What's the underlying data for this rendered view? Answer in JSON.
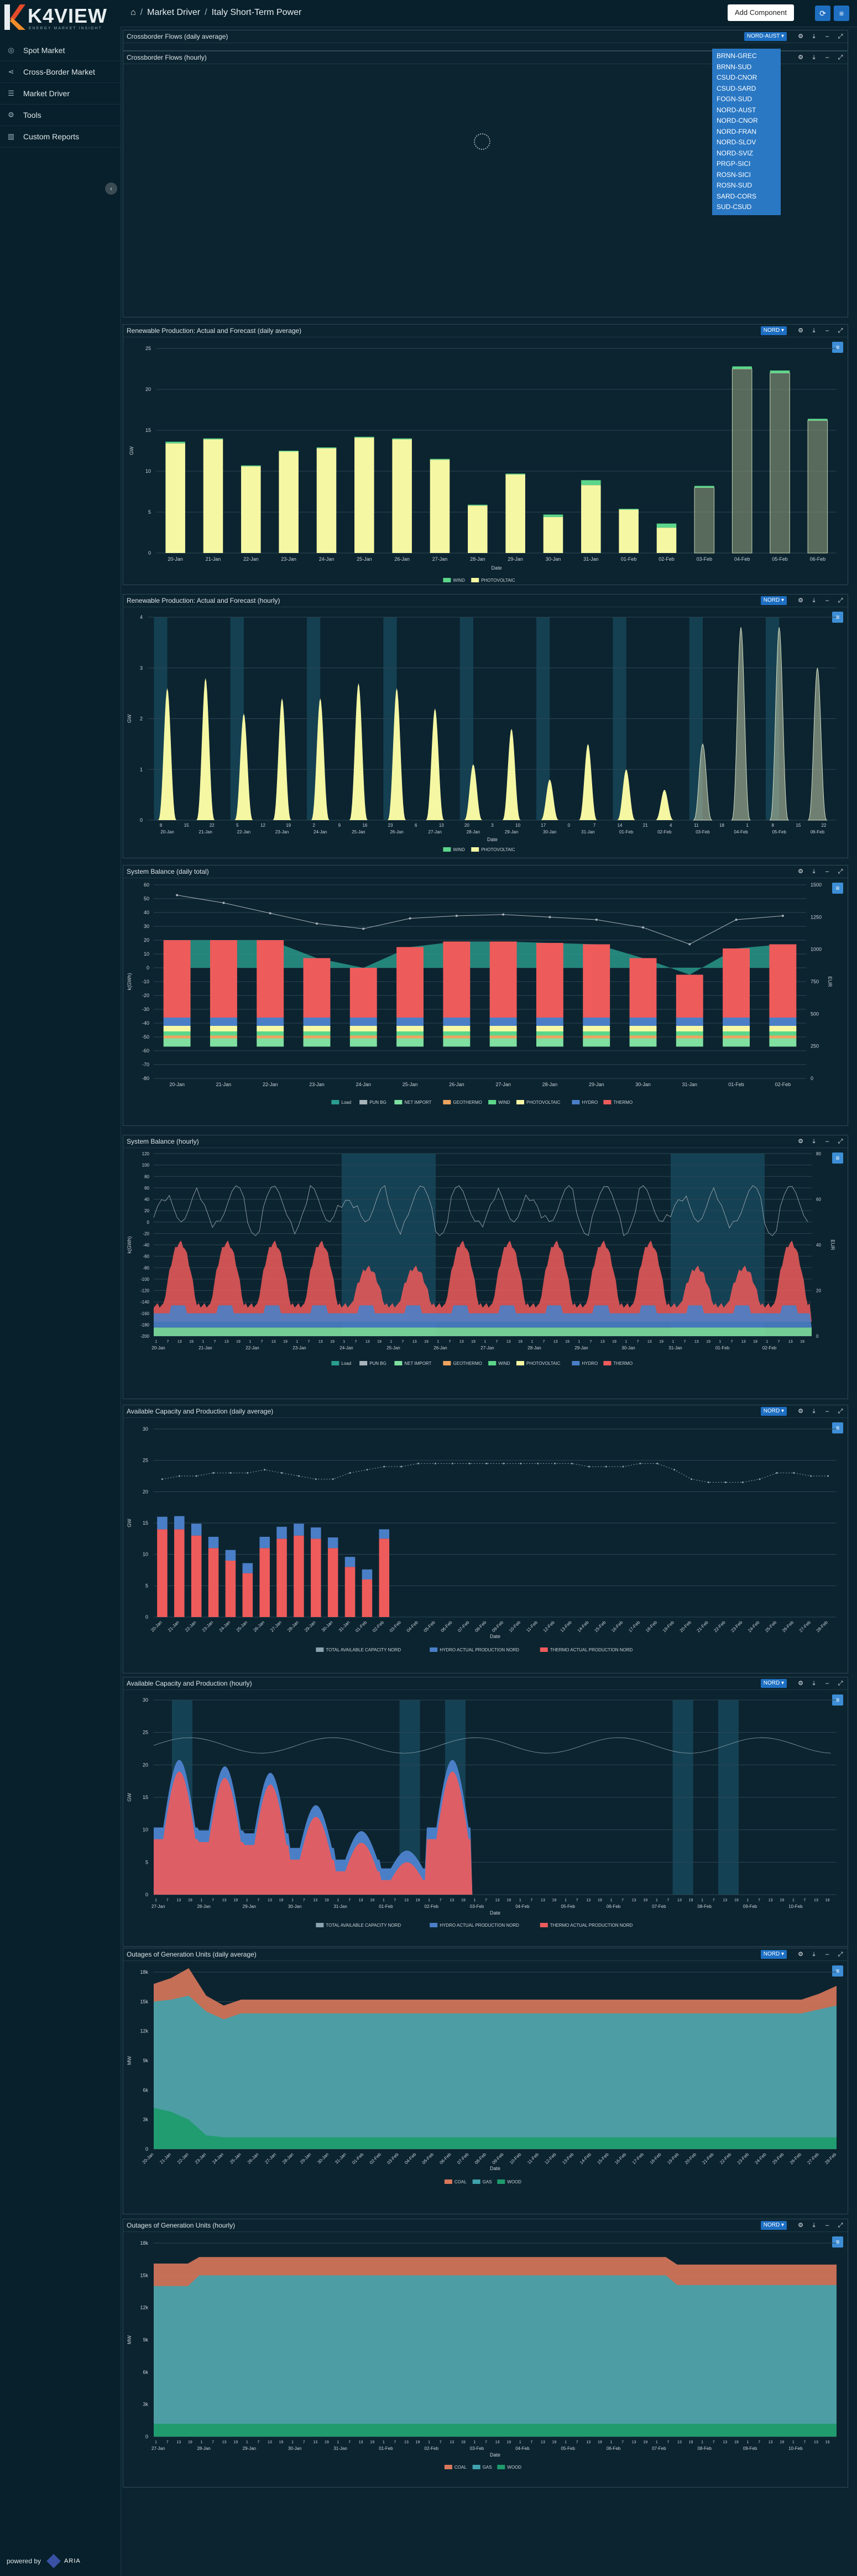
{
  "app": {
    "logo_text": "K4VIEW",
    "logo_sub": "ENERGY MARKET INSIGHT",
    "powered_by": "powered by",
    "powered_name": "ARIA"
  },
  "sidebar": {
    "items": [
      {
        "label": "Spot Market",
        "icon": "globe-icon"
      },
      {
        "label": "Cross-Border Market",
        "icon": "share-icon"
      },
      {
        "label": "Market Driver",
        "icon": "sliders-icon"
      },
      {
        "label": "Tools",
        "icon": "gear-icon"
      },
      {
        "label": "Custom Reports",
        "icon": "bar-chart-icon"
      }
    ]
  },
  "breadcrumb": {
    "parent": "Market Driver",
    "current": "Italy Short-Term Power"
  },
  "topbar": {
    "add_component": "Add Component"
  },
  "dropdown": {
    "selected": "NORD-AUST",
    "options": [
      "BRNN-GREC",
      "BRNN-SUD",
      "CSUD-CNOR",
      "CSUD-SARD",
      "FOGN-SUD",
      "NORD-AUST",
      "NORD-CNOR",
      "NORD-FRAN",
      "NORD-SLOV",
      "NORD-SVIZ",
      "PRGP-SICI",
      "ROSN-SICI",
      "ROSN-SUD",
      "SARD-CORS",
      "SUD-CSUD"
    ]
  },
  "panels": {
    "cbf_daily": {
      "title": "Crossborder Flows (daily average)"
    },
    "cbf_hourly": {
      "title": "Crossborder Flows (hourly)"
    },
    "ren_daily": {
      "title": "Renewable Production: Actual and Forecast (daily average)",
      "select": "NORD"
    },
    "ren_hourly": {
      "title": "Renewable Production: Actual and Forecast (hourly)",
      "select": "NORD"
    },
    "bal_daily": {
      "title": "System Balance (daily total)"
    },
    "bal_hourly": {
      "title": "System Balance (hourly)"
    },
    "cap_daily": {
      "title": "Available Capacity and Production (daily average)",
      "select": "NORD"
    },
    "cap_hourly": {
      "title": "Available Capacity and Production (hourly)",
      "select": "NORD"
    },
    "out_daily": {
      "title": "Outages of Generation Units (daily average)",
      "select": "NORD"
    },
    "out_hourly": {
      "title": "Outages of Generation Units (hourly)",
      "select": "NORD"
    }
  },
  "colors": {
    "wind": "#5cd68a",
    "photovoltaic": "#f5f7a3",
    "load": "#2a9d8f",
    "pun": "#a9b4ba",
    "net_import": "#7fe0a0",
    "geothermo": "#f0a35e",
    "hydro": "#4a7fc7",
    "thermo": "#ee5b5b",
    "coal": "#d9785b",
    "gas": "#3fa3ad",
    "wood": "#1d9b6c"
  },
  "chart_data": [
    {
      "id": "ren_daily",
      "type": "bar",
      "categories": [
        "20-Jan",
        "21-Jan",
        "22-Jan",
        "23-Jan",
        "24-Jan",
        "25-Jan",
        "26-Jan",
        "27-Jan",
        "28-Jan",
        "29-Jan",
        "30-Jan",
        "31-Jan",
        "01-Feb",
        "02-Feb",
        "03-Feb",
        "04-Feb",
        "05-Feb",
        "06-Feb"
      ],
      "series": [
        {
          "name": "WIND",
          "values": [
            0.2,
            0.1,
            0.1,
            0.1,
            0.1,
            0.1,
            0.1,
            0.1,
            0.1,
            0.1,
            0.3,
            0.6,
            0.1,
            0.5,
            0.2,
            0.3,
            0.3,
            0.2
          ]
        },
        {
          "name": "PHOTOVOLTAIC",
          "values": [
            13.4,
            13.9,
            10.6,
            12.4,
            12.8,
            14.1,
            13.9,
            11.4,
            5.8,
            9.6,
            4.4,
            8.3,
            5.3,
            3.1,
            8.0,
            22.5,
            22.0,
            16.2
          ]
        }
      ],
      "forecast_from": "03-Feb",
      "ylabel": "GW",
      "xlabel": "Date",
      "ylim": [
        0,
        25
      ],
      "yticks": [
        0,
        5,
        10,
        15,
        20,
        25
      ],
      "legend": [
        "WIND",
        "PHOTOVOLTAIC"
      ],
      "legend_position": "bottom"
    },
    {
      "id": "ren_hourly",
      "type": "area",
      "categories": [
        "20-Jan",
        "21-Jan",
        "22-Jan",
        "23-Jan",
        "24-Jan",
        "25-Jan",
        "26-Jan",
        "27-Jan",
        "28-Jan",
        "29-Jan",
        "30-Jan",
        "31-Jan",
        "01-Feb",
        "02-Feb",
        "03-Feb",
        "04-Feb",
        "05-Feb",
        "06-Feb"
      ],
      "daily_peak": [
        2.6,
        2.8,
        2.1,
        2.4,
        2.4,
        2.7,
        2.6,
        2.2,
        1.1,
        1.8,
        0.8,
        1.5,
        1.0,
        0.6,
        1.5,
        3.8,
        3.8,
        3.0
      ],
      "hour_ticks": [
        "8",
        "15",
        "22",
        "5",
        "12",
        "19",
        "2",
        "9",
        "16",
        "23",
        "6",
        "13",
        "20",
        "3",
        "10",
        "17",
        "0",
        "7",
        "14",
        "21",
        "4",
        "11",
        "18",
        "1",
        "8",
        "15",
        "22"
      ],
      "series_names": [
        "WIND",
        "PHOTOVOLTAIC"
      ],
      "ylabel": "GW",
      "xlabel": "Date",
      "ylim": [
        0,
        4
      ],
      "yticks": [
        0,
        1,
        2,
        3,
        4
      ],
      "legend": [
        "WIND",
        "PHOTOVOLTAIC"
      ]
    },
    {
      "id": "bal_daily",
      "type": "bar",
      "categories": [
        "20-Jan",
        "21-Jan",
        "22-Jan",
        "23-Jan",
        "24-Jan",
        "25-Jan",
        "26-Jan",
        "27-Jan",
        "28-Jan",
        "29-Jan",
        "30-Jan",
        "31-Jan",
        "01-Feb",
        "02-Feb"
      ],
      "thermo_top": [
        20,
        20,
        20,
        7,
        0,
        15,
        19,
        19,
        18,
        17,
        7,
        -5,
        14,
        17
      ],
      "pun": [
        1420,
        1360,
        1280,
        1200,
        1160,
        1240,
        1260,
        1270,
        1250,
        1230,
        1170,
        1040,
        1230,
        1260
      ],
      "ylabel_left": "k(GWh)",
      "ylabel_right": "EUR",
      "ylim_left": [
        -80,
        60
      ],
      "yticks_left": [
        60,
        50,
        40,
        30,
        20,
        10,
        0,
        -10,
        -20,
        -30,
        -40,
        -50,
        -60,
        -70,
        -80
      ],
      "ylim_right": [
        0,
        1500
      ],
      "yticks_right": [
        1500,
        1250,
        1000,
        750,
        500,
        250,
        0
      ],
      "legend": [
        "Load",
        "PUN BG",
        "NET IMPORT",
        "GEOTHERMO",
        "WIND",
        "PHOTOVOLTAIC",
        "HYDRO",
        "THERMO"
      ]
    },
    {
      "id": "bal_hourly",
      "type": "area",
      "categories": [
        "20-Jan",
        "21-Jan",
        "22-Jan",
        "23-Jan",
        "24-Jan",
        "25-Jan",
        "26-Jan",
        "27-Jan",
        "28-Jan",
        "29-Jan",
        "30-Jan",
        "31-Jan",
        "01-Feb",
        "02-Feb"
      ],
      "hour_ticks": [
        "1",
        "7",
        "13",
        "19"
      ],
      "ylabel_left": "k(GWh)",
      "ylabel_right": "EUR",
      "ylim_left": [
        -200,
        120
      ],
      "yticks_left": [
        120,
        100,
        80,
        60,
        40,
        20,
        0,
        -20,
        -40,
        -60,
        -80,
        -100,
        -120,
        -140,
        -160,
        -180,
        -200
      ],
      "ylim_right": [
        0,
        80
      ],
      "yticks_right": [
        80,
        60,
        40,
        20,
        0
      ],
      "legend": [
        "Load",
        "PUN BG",
        "NET IMPORT",
        "GEOTHERMO",
        "WIND",
        "PHOTOVOLTAIC",
        "HYDRO",
        "THERMO"
      ]
    },
    {
      "id": "cap_daily",
      "type": "bar",
      "categories": [
        "20-Jan",
        "21-Jan",
        "22-Jan",
        "23-Jan",
        "24-Jan",
        "25-Jan",
        "26-Jan",
        "27-Jan",
        "28-Jan",
        "29-Jan",
        "30-Jan",
        "31-Jan",
        "01-Feb",
        "02-Feb",
        "03-Feb",
        "04-Feb",
        "05-Feb",
        "06-Feb",
        "07-Feb",
        "08-Feb",
        "09-Feb",
        "10-Feb",
        "11-Feb",
        "12-Feb",
        "13-Feb",
        "14-Feb",
        "15-Feb",
        "16-Feb",
        "17-Feb",
        "18-Feb",
        "19-Feb",
        "20-Feb",
        "21-Feb",
        "22-Feb",
        "23-Feb",
        "24-Feb",
        "25-Feb",
        "26-Feb",
        "27-Feb",
        "28-Feb"
      ],
      "series": [
        {
          "name": "HYDRO ACTUAL PRODUCTION NORD",
          "values": [
            2.0,
            2.1,
            1.9,
            1.8,
            1.7,
            1.6,
            1.8,
            1.9,
            1.9,
            1.8,
            1.7,
            1.6,
            1.6,
            1.5
          ]
        },
        {
          "name": "THERMO ACTUAL PRODUCTION NORD",
          "values": [
            14,
            14,
            13,
            11,
            9,
            7,
            11,
            12.5,
            13,
            12.5,
            11,
            8,
            6,
            12.5
          ]
        }
      ],
      "capacity": [
        22,
        22.5,
        22.5,
        23,
        23,
        23,
        23.5,
        23,
        22.5,
        22,
        22,
        23,
        23.5,
        24,
        24,
        24.5,
        24.5,
        24.5,
        24.5,
        24.5,
        24.5,
        24.5,
        24.5,
        24.5,
        24.5,
        24,
        24,
        24,
        24.5,
        24.5,
        23.5,
        22,
        21.5,
        21.5,
        21.5,
        22,
        23,
        23,
        22.5,
        22.5
      ],
      "ylabel": "GW",
      "xlabel": "Date",
      "ylim": [
        0,
        30
      ],
      "yticks": [
        0,
        5,
        10,
        15,
        20,
        25,
        30
      ],
      "legend": [
        "TOTAL AVAILABLE CAPACITY NORD",
        "HYDRO ACTUAL PRODUCTION NORD",
        "THERMO ACTUAL PRODUCTION NORD"
      ]
    },
    {
      "id": "cap_hourly",
      "type": "area",
      "categories": [
        "27-Jan",
        "28-Jan",
        "29-Jan",
        "30-Jan",
        "31-Jan",
        "01-Feb",
        "02-Feb",
        "03-Feb",
        "04-Feb",
        "05-Feb",
        "06-Feb",
        "07-Feb",
        "08-Feb",
        "09-Feb",
        "10-Feb"
      ],
      "hour_ticks": [
        "1",
        "7",
        "13",
        "19"
      ],
      "ylabel": "GW",
      "xlabel": "Date",
      "ylim": [
        0,
        30
      ],
      "yticks": [
        0,
        5,
        10,
        15,
        20,
        25,
        30
      ],
      "legend": [
        "TOTAL AVAILABLE CAPACITY NORD",
        "HYDRO ACTUAL PRODUCTION NORD",
        "THERMO ACTUAL PRODUCTION NORD"
      ]
    },
    {
      "id": "out_daily",
      "type": "area",
      "categories": [
        "20-Jan",
        "21-Jan",
        "22-Jan",
        "23-Jan",
        "24-Jan",
        "25-Jan",
        "26-Jan",
        "27-Jan",
        "28-Jan",
        "29-Jan",
        "30-Jan",
        "31-Jan",
        "01-Feb",
        "02-Feb",
        "03-Feb",
        "04-Feb",
        "05-Feb",
        "06-Feb",
        "07-Feb",
        "08-Feb",
        "09-Feb",
        "10-Feb",
        "11-Feb",
        "12-Feb",
        "13-Feb",
        "14-Feb",
        "15-Feb",
        "16-Feb",
        "17-Feb",
        "18-Feb",
        "19-Feb",
        "20-Feb",
        "21-Feb",
        "22-Feb",
        "23-Feb",
        "24-Feb",
        "25-Feb",
        "26-Feb",
        "27-Feb",
        "28-Feb"
      ],
      "series": [
        {
          "name": "WOOD",
          "values": [
            4.2,
            3.8,
            3.0,
            1.4,
            1.2,
            1.2,
            1.2,
            1.2,
            1.2,
            1.2,
            1.2,
            1.2,
            1.2,
            1.2,
            1.2,
            1.2,
            1.2,
            1.2,
            1.2,
            1.2,
            1.2,
            1.2,
            1.2,
            1.2,
            1.2,
            1.2,
            1.2,
            1.2,
            1.2,
            1.2,
            1.2,
            1.2,
            1.2,
            1.2,
            1.2,
            1.2,
            1.2,
            1.2,
            1.2,
            1.2
          ]
        },
        {
          "name": "GAS",
          "values": [
            10.8,
            11.4,
            12.6,
            12.6,
            12.0,
            12.6,
            12.6,
            12.6,
            12.6,
            12.6,
            12.6,
            12.6,
            12.6,
            12.6,
            12.6,
            12.6,
            12.6,
            12.6,
            12.6,
            12.6,
            12.6,
            12.6,
            12.6,
            12.6,
            12.6,
            12.6,
            12.6,
            12.6,
            12.6,
            12.6,
            12.6,
            12.6,
            12.6,
            12.6,
            12.6,
            12.6,
            12.6,
            12.6,
            13.0,
            13.4
          ]
        },
        {
          "name": "COAL",
          "values": [
            1.8,
            2.2,
            2.8,
            1.6,
            1.4,
            1.4,
            1.4,
            1.4,
            1.4,
            1.4,
            1.4,
            1.4,
            1.4,
            1.4,
            1.4,
            1.4,
            1.4,
            1.4,
            1.4,
            1.4,
            1.4,
            1.4,
            1.4,
            1.4,
            1.4,
            1.4,
            1.4,
            1.4,
            1.4,
            1.4,
            1.4,
            1.4,
            1.4,
            1.4,
            1.4,
            1.4,
            1.4,
            1.4,
            1.6,
            2.0
          ]
        }
      ],
      "ylabel": "MW",
      "xlabel": "Date",
      "ylim": [
        0,
        18
      ],
      "yticks": [
        "0",
        "3k",
        "6k",
        "9k",
        "12k",
        "15k",
        "18k"
      ],
      "legend": [
        "COAL",
        "GAS",
        "WOOD"
      ]
    },
    {
      "id": "out_hourly",
      "type": "area",
      "categories": [
        "27-Jan",
        "28-Jan",
        "29-Jan",
        "30-Jan",
        "31-Jan",
        "01-Feb",
        "02-Feb",
        "03-Feb",
        "04-Feb",
        "05-Feb",
        "06-Feb",
        "07-Feb",
        "08-Feb",
        "09-Feb",
        "10-Feb"
      ],
      "hour_ticks": [
        "1",
        "7",
        "13",
        "19"
      ],
      "ylabel": "MW",
      "xlabel": "Date",
      "ylim": [
        0,
        18
      ],
      "yticks": [
        "0",
        "3k",
        "6k",
        "9k",
        "12k",
        "15k",
        "18k"
      ],
      "legend": [
        "COAL",
        "GAS",
        "WOOD"
      ]
    }
  ]
}
